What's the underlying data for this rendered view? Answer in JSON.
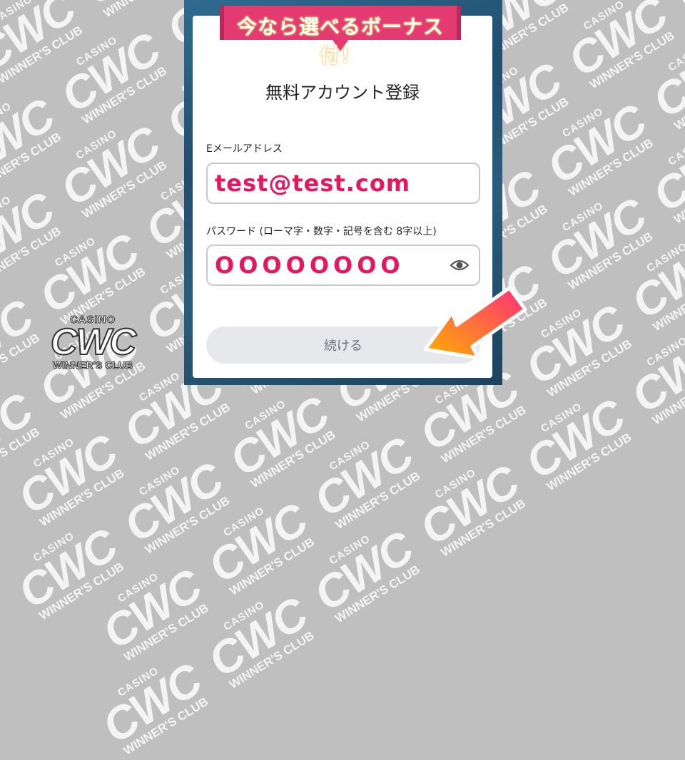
{
  "watermark": {
    "casino": "CASINO",
    "cwc": "CWC",
    "winners": "WINNER'S CLUB"
  },
  "ribbon": {
    "text": "今なら選べるボーナス付！"
  },
  "form": {
    "title": "無料アカウント登録",
    "email": {
      "label": "Eメールアドレス",
      "value": "test@test.com"
    },
    "password": {
      "label": "パスワード (ローマ字・数字・記号を含む 8字以上)",
      "value": "OOOOOOOO",
      "visibility_icon": "eye-icon"
    },
    "continue_label": "続ける"
  },
  "logo": {
    "casino": "CASINO",
    "cwc": "CWC",
    "winners": "WINNER'S CLUB"
  },
  "colors": {
    "accent": "#e8175d",
    "ribbon": "#e33a72",
    "arrow_start": "#ff2e7a",
    "arrow_end": "#ffb000"
  }
}
